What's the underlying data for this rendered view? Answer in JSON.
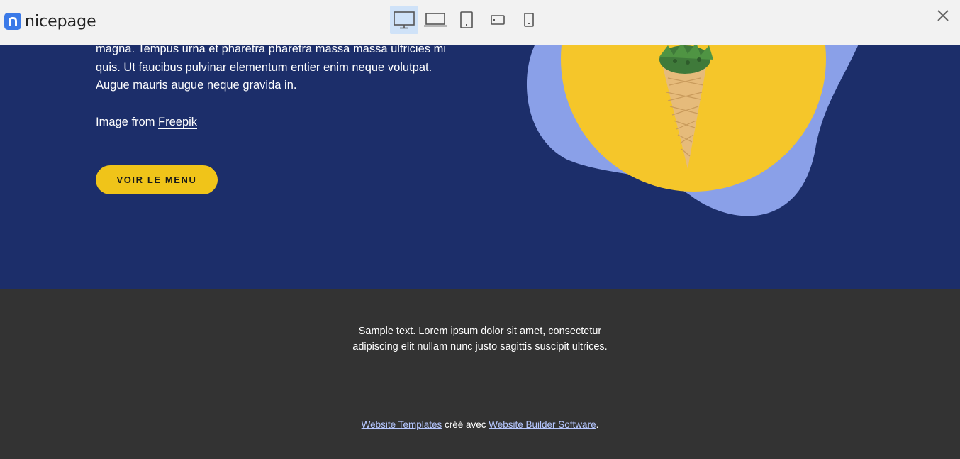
{
  "topbar": {
    "logo_text": "nicepage",
    "devices": [
      {
        "name": "desktop",
        "active": true
      },
      {
        "name": "laptop",
        "active": false
      },
      {
        "name": "tablet",
        "active": false
      },
      {
        "name": "phone-landscape",
        "active": false
      },
      {
        "name": "phone",
        "active": false
      }
    ],
    "close_icon": "close-icon"
  },
  "hero": {
    "paragraph_line1": "magna. Tempus urna et pharetra pharetra massa massa ultricies mi",
    "paragraph_line2_before": "quis. Ut faucibus pulvinar elementum ",
    "paragraph_link": "entier",
    "paragraph_line2_after": " enim neque volutpat.",
    "paragraph_line3": "Augue mauris augue neque gravida in.",
    "credit_prefix": "Image from ",
    "credit_link": "Freepik",
    "cta_label": "VOIR LE MENU",
    "colors": {
      "background": "#1c2e6a",
      "cta": "#f0c419",
      "blob": "#8aa0e8",
      "circle": "#f5c62a"
    }
  },
  "footer": {
    "text_line1": "Sample text. Lorem ipsum dolor sit amet, consectetur",
    "text_line2": "adipiscing elit nullam nunc justo sagittis suscipit ultrices.",
    "link1": "Website Templates",
    "middle": " créé avec ",
    "link2": "Website Builder Software",
    "end": ".",
    "colors": {
      "background": "#333333",
      "link": "#b6c7ff"
    }
  }
}
